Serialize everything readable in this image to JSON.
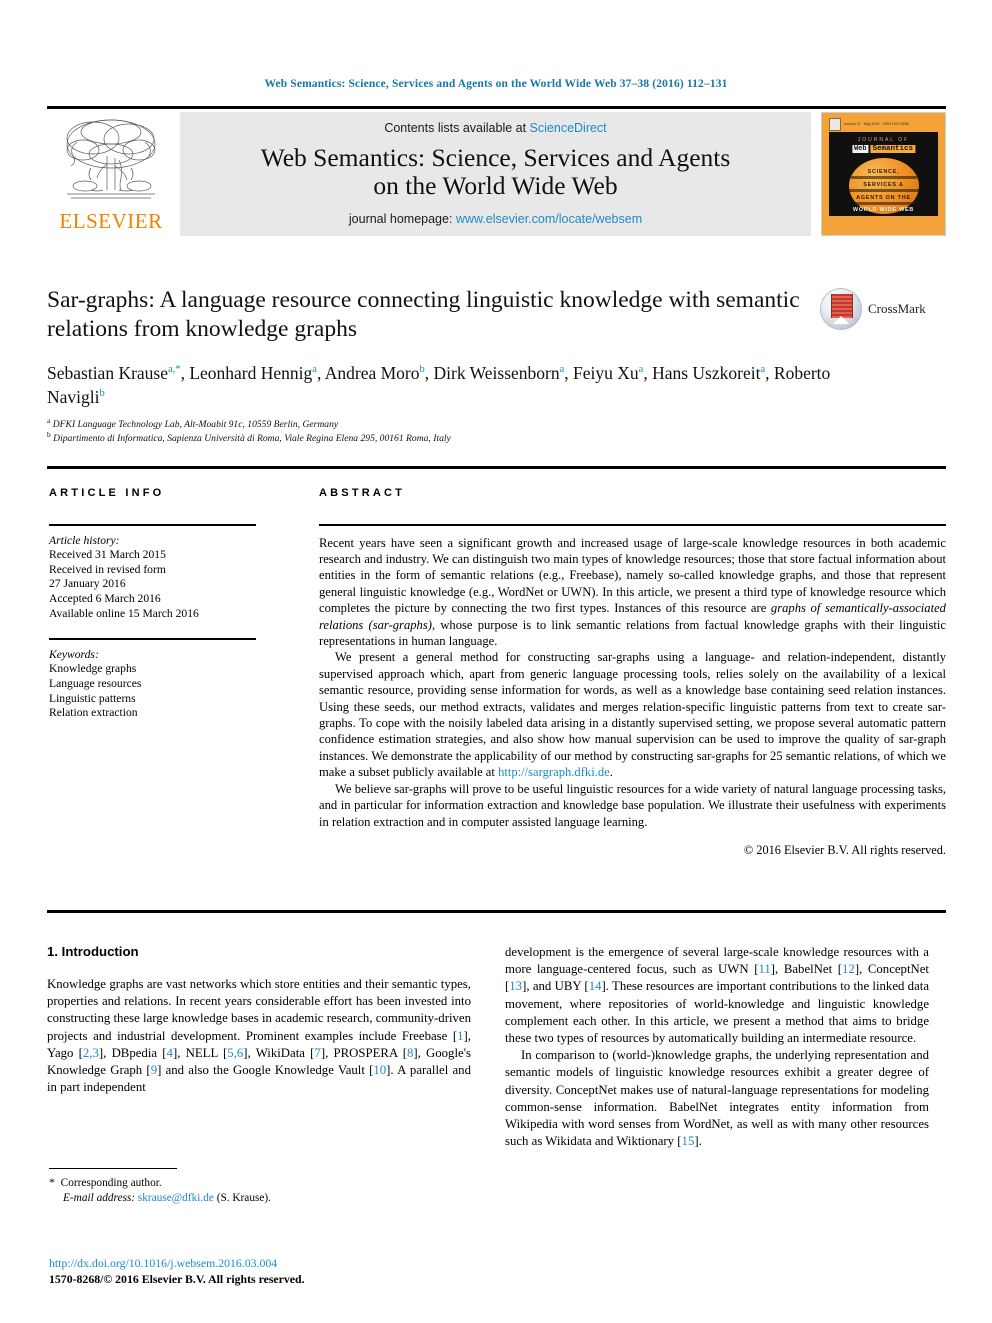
{
  "running_head": "Web Semantics: Science, Services and Agents on the World Wide Web 37–38 (2016) 112–131",
  "masthead": {
    "contents_prefix": "Contents lists available at ",
    "sciencedirect": "ScienceDirect",
    "journal_title_line1": "Web Semantics: Science, Services and Agents",
    "journal_title_line2": "on the World Wide Web",
    "homepage_prefix": "journal homepage: ",
    "homepage_url": "www.elsevier.com/locate/websem",
    "publisher": "ELSEVIER",
    "cover": {
      "top_left": "ELSEVIER",
      "top_items": [
        "Volume 37",
        "May 2016",
        "ISSN 1570-8268"
      ],
      "journal_of": "JOURNAL  OF",
      "web": "Web",
      "semantics": "Semantics",
      "line1": "SCIENCE,",
      "line2": "SERVICES &",
      "line3": "AGENTS ON THE",
      "line4": "WORLD WIDE WEB"
    }
  },
  "article": {
    "title": "Sar-graphs: A language resource connecting linguistic knowledge with semantic relations from knowledge graphs",
    "crossmark_label": "CrossMark",
    "authors_html": "Sebastian Krause <sup>a,*</sup>, Leonhard Hennig <sup>a</sup>, Andrea Moro <sup>b</sup>, Dirk Weissenborn <sup>a</sup>, Feiyu Xu <sup>a</sup>, Hans Uszkoreit <sup>a</sup>, Roberto Navigli <sup>b</sup>",
    "affiliations": [
      "DFKI Language Technology Lab, Alt-Moabit 91c, 10559 Berlin, Germany",
      "Dipartimento di Informatica, Sapienza Università di Roma, Viale Regina Elena 295, 00161 Roma, Italy"
    ],
    "affiliation_marks": [
      "a",
      "b"
    ]
  },
  "sections": {
    "article_info_label": "ARTICLE INFO",
    "abstract_label": "ABSTRACT"
  },
  "article_info": {
    "history_head": "Article history:",
    "history_lines": [
      "Received 31 March 2015",
      "Received in revised form",
      "27 January 2016",
      "Accepted 6 March 2016",
      "Available online 15 March 2016"
    ],
    "keywords_head": "Keywords:",
    "keywords": [
      "Knowledge graphs",
      "Language resources",
      "Linguistic patterns",
      "Relation extraction"
    ]
  },
  "abstract": {
    "p1_a": "Recent years have seen a significant growth and increased usage of large-scale knowledge resources in both academic research and industry. We can distinguish two main types of knowledge resources; those that store factual information about entities in the form of semantic relations (e.g., Freebase), namely so-called knowledge graphs, and those that represent general linguistic knowledge (e.g., WordNet or UWN). In this article, we present a third type of knowledge resource which completes the picture by connecting the two first types. Instances of this resource are ",
    "p1_italic": "graphs of semantically-associated relations (sar-graphs)",
    "p1_b": ", whose purpose is to link semantic relations from factual knowledge graphs with their linguistic representations in human language.",
    "p2_a": "We present a general method for constructing sar-graphs using a language- and relation-independent, distantly supervised approach which, apart from generic language processing tools, relies solely on the availability of a lexical semantic resource, providing sense information for words, as well as a knowledge base containing seed relation instances. Using these seeds, our method extracts, validates and merges relation-specific linguistic patterns from text to create sar-graphs. To cope with the noisily labeled data arising in a distantly supervised setting, we propose several automatic pattern confidence estimation strategies, and also show how manual supervision can be used to improve the quality of sar-graph instances. We demonstrate the applicability of our method by constructing sar-graphs for 25 semantic relations, of which we make a subset publicly available at ",
    "p2_link": "http://sargraph.dfki.de",
    "p2_b": ".",
    "p3": "We believe sar-graphs will prove to be useful linguistic resources for a wide variety of natural language processing tasks, and in particular for information extraction and knowledge base population. We illustrate their usefulness with experiments in relation extraction and in computer assisted language learning.",
    "copyright": "© 2016 Elsevier B.V. All rights reserved."
  },
  "introduction": {
    "heading": "1. Introduction",
    "left_p1_a": "Knowledge graphs are vast networks which store entities and their semantic types, properties and relations. In recent years considerable effort has been invested into constructing these large knowledge bases in academic research, community-driven projects and industrial development. Prominent examples include Freebase [",
    "refs_line": {
      "r1": "1",
      "r2": "2,3",
      "r3": "4",
      "r4": "5,6",
      "r5": "7",
      "r6": "8",
      "r7": "9",
      "r8": "10"
    },
    "left_p1_parts": [
      "], Yago [",
      "], DBpedia [",
      "], NELL [",
      "], WikiData [",
      "], PROSPERA [",
      "], Google's Knowledge Graph [",
      "] and also the Google Knowledge Vault [",
      "]. A parallel and in part independent"
    ],
    "right_p1_a": "development is the emergence of several large-scale knowledge resources with a more language-centered focus, such as UWN [",
    "right_refs": {
      "r11": "11",
      "r12": "12",
      "r13": "13",
      "r14": "14",
      "r15": "15"
    },
    "right_p1_parts": [
      "], BabelNet [",
      "], ConceptNet [",
      "], and UBY [",
      "]. These resources are important contributions to the linked data movement, where repositories of world-knowledge and linguistic knowledge complement each other. In this article, we present a method that aims to bridge these two types of resources by automatically building an intermediate resource."
    ],
    "right_p2_a": "In comparison to (world-)knowledge graphs, the underlying representation and semantic models of linguistic knowledge resources exhibit a greater degree of diversity. ConceptNet makes use of natural-language representations for modeling common-sense information. BabelNet integrates entity information from Wikipedia with word senses from WordNet, as well as with many other resources such as Wikidata and Wiktionary [",
    "right_p2_b": "]."
  },
  "footnote": {
    "star": "*",
    "corresponding": "Corresponding author.",
    "email_label": "E-mail address:",
    "email": "skrause@dfki.de",
    "email_suffix": "(S. Krause).",
    "doi": "http://dx.doi.org/10.1016/j.websem.2016.03.004",
    "issn_line": "1570-8268/© 2016 Elsevier B.V. All rights reserved."
  },
  "colors": {
    "link": "#1c8ac7",
    "running_head": "#1678a8",
    "elsevier_orange": "#ef8200",
    "masthead_bg": "#e8e8e8",
    "cover_orange": "#f4a23a"
  }
}
